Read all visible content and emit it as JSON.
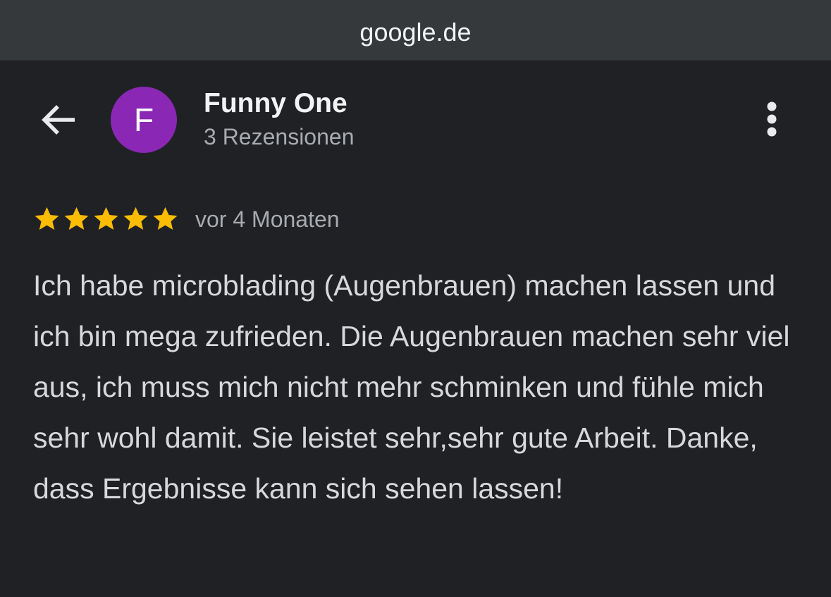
{
  "browser": {
    "url": "google.de"
  },
  "header": {
    "back_icon": "arrow-left-icon",
    "avatar_letter": "F",
    "avatar_color": "#8a28b5",
    "user_name": "Funny One",
    "review_count": "3 Rezensionen",
    "more_icon": "more-vertical-icon"
  },
  "review": {
    "rating": 5,
    "max_rating": 5,
    "star_color": "#fbbc04",
    "time_ago": "vor 4 Monaten",
    "text": "Ich habe microblading (Augenbrauen) machen lassen und ich bin mega zufrieden. Die Augenbrauen machen sehr viel aus, ich muss mich nicht mehr schminken und fühle mich sehr wohl damit. Sie leistet sehr,sehr gute Arbeit. Danke, dass Ergebnisse kann sich sehen lassen!"
  }
}
